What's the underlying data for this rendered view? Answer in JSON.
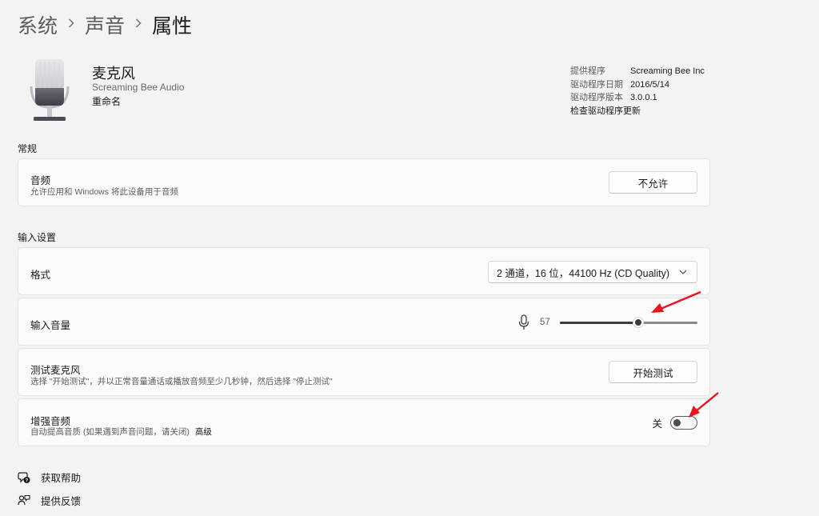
{
  "breadcrumb": {
    "items": [
      "系统",
      "声音",
      "属性"
    ]
  },
  "device": {
    "name": "麦克风",
    "subtitle": "Screaming Bee Audio",
    "rename_label": "重命名",
    "icon": "microphone-illustration"
  },
  "driver": {
    "provider_label": "提供程序",
    "provider_value": "Screaming Bee Inc",
    "date_label": "驱动程序日期",
    "date_value": "2016/5/14",
    "version_label": "驱动程序版本",
    "version_value": "3.0.0.1",
    "check_link": "检查驱动程序更新"
  },
  "general": {
    "section_title": "常规",
    "audio": {
      "title": "音频",
      "description": "允许应用和 Windows 将此设备用于音频",
      "button_label": "不允许"
    }
  },
  "input_settings": {
    "section_title": "输入设置",
    "format": {
      "title": "格式",
      "selected": "2 通道，16 位，44100 Hz (CD Quality)",
      "icon": "chevron-down-icon"
    },
    "volume": {
      "title": "输入音量",
      "value": "57",
      "level_percent": 57,
      "icon": "microphone-icon"
    },
    "test": {
      "title": "测试麦克风",
      "description": "选择 \"开始测试\"，并以正常音量通话或播放音频至少几秒钟，然后选择 \"停止测试\"",
      "button_label": "开始测试"
    },
    "enhance": {
      "title": "增强音频",
      "description": "自动提高音质 (如果遇到声音问题，请关闭)",
      "advanced_link": "高级",
      "toggle_label": "关",
      "toggle_on": false
    }
  },
  "footer": {
    "help_label": "获取帮助",
    "help_icon": "help-icon",
    "feedback_label": "提供反馈",
    "feedback_icon": "feedback-icon"
  },
  "colors": {
    "background": "#f3f3f3",
    "card": "#fbfbfb",
    "annotation_arrow": "#e8141b"
  }
}
